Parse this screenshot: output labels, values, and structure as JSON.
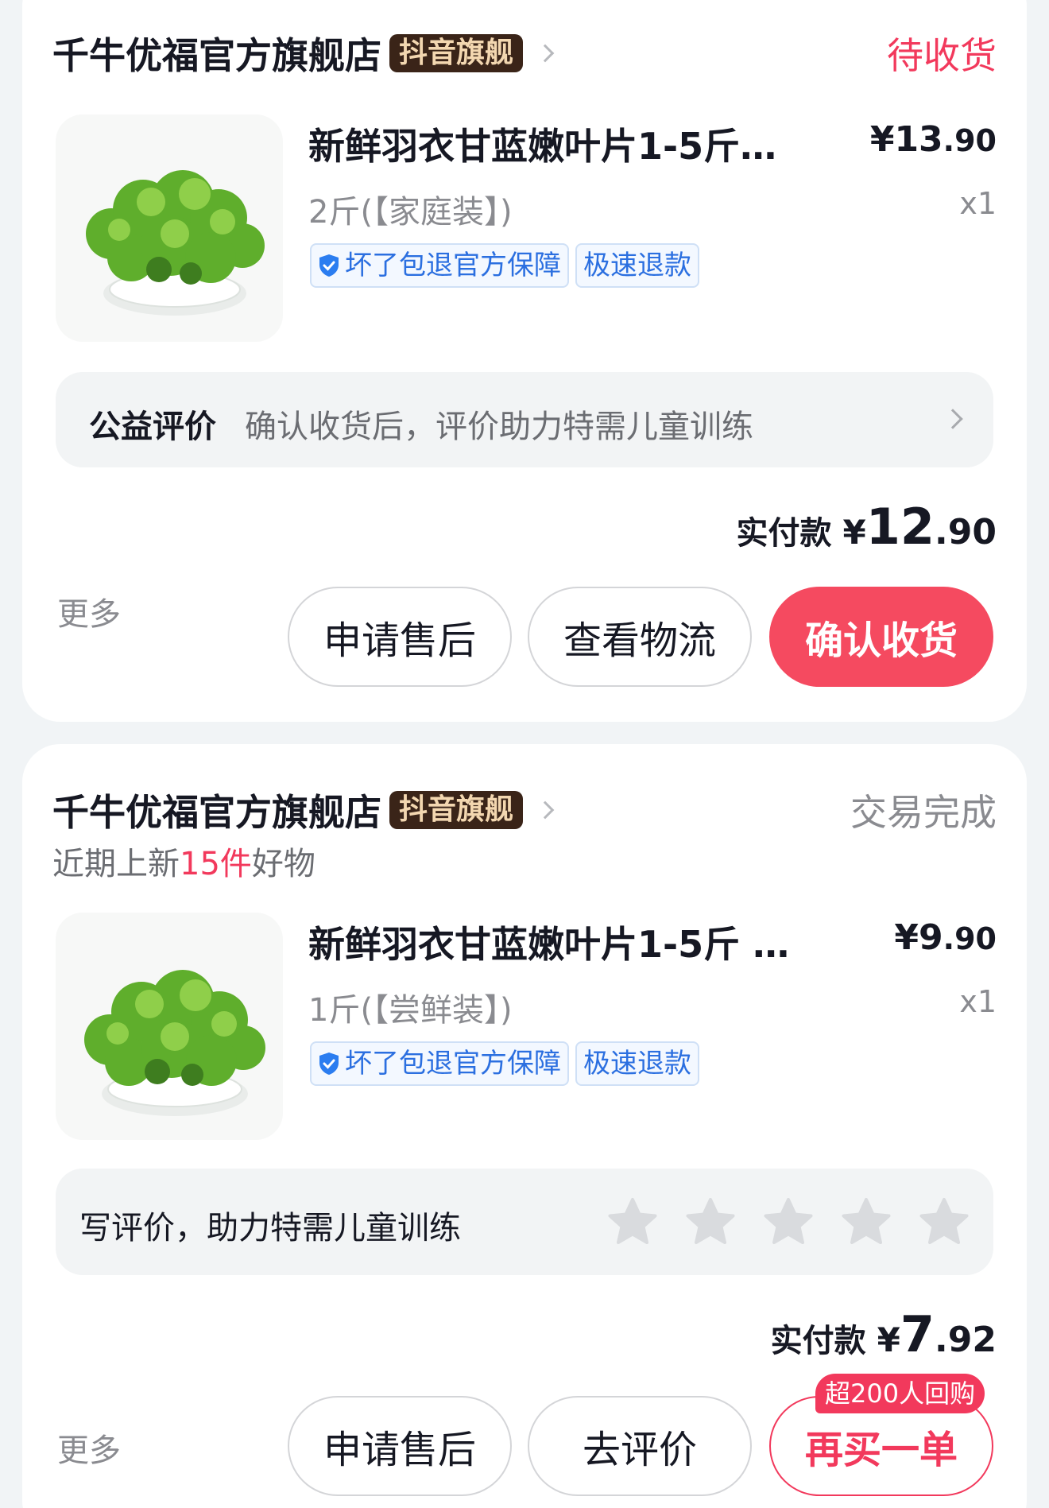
{
  "orders": [
    {
      "store_name": "千牛优福官方旗舰店",
      "store_badge": "抖音旗舰",
      "status": "待收货",
      "product_title": "新鲜羽衣甘蓝嫩叶片1-5斤…",
      "price_currency": "¥",
      "price_int": "13",
      "price_dec": ".90",
      "variant": "2斤(【家庭装】)",
      "quantity": "x1",
      "tags": [
        "坏了包退官方保障",
        "极速退款"
      ],
      "strip_bold": "公益评价",
      "strip_text": "确认收货后，评价助力特需儿童训练",
      "paid_label": "实付款",
      "paid_currency": "¥",
      "paid_int": "12",
      "paid_dec": ".90",
      "more": "更多",
      "buttons": [
        "申请售后",
        "查看物流",
        "确认收货"
      ]
    },
    {
      "store_name": "千牛优福官方旗舰店",
      "store_badge": "抖音旗舰",
      "status": "交易完成",
      "subline_prefix": "近期上新",
      "subline_highlight": "15件",
      "subline_suffix": "好物",
      "product_title": "新鲜羽衣甘蓝嫩叶片1-5斤 …",
      "price_currency": "¥",
      "price_int": "9",
      "price_dec": ".90",
      "variant": "1斤(【尝鲜装】)",
      "quantity": "x1",
      "tags": [
        "坏了包退官方保障",
        "极速退款"
      ],
      "review_prompt": "写评价，助力特需儿童训练",
      "star_count": 5,
      "paid_label": "实付款",
      "paid_currency": "¥",
      "paid_int": "7",
      "paid_dec": ".92",
      "more": "更多",
      "buttons": [
        "申请售后",
        "去评价",
        "再买一单"
      ],
      "rebuy_badge": "超200人回购"
    }
  ],
  "colors": {
    "accent_red": "#f2395c",
    "primary_button": "#f54a60",
    "tag_blue": "#2b6fe0",
    "badge_dark": "#3a2418",
    "page_bg": "#f1f4f6"
  },
  "icons": [
    "chevron-right-icon",
    "shield-check-icon",
    "star-icon",
    "kale-product-image"
  ]
}
